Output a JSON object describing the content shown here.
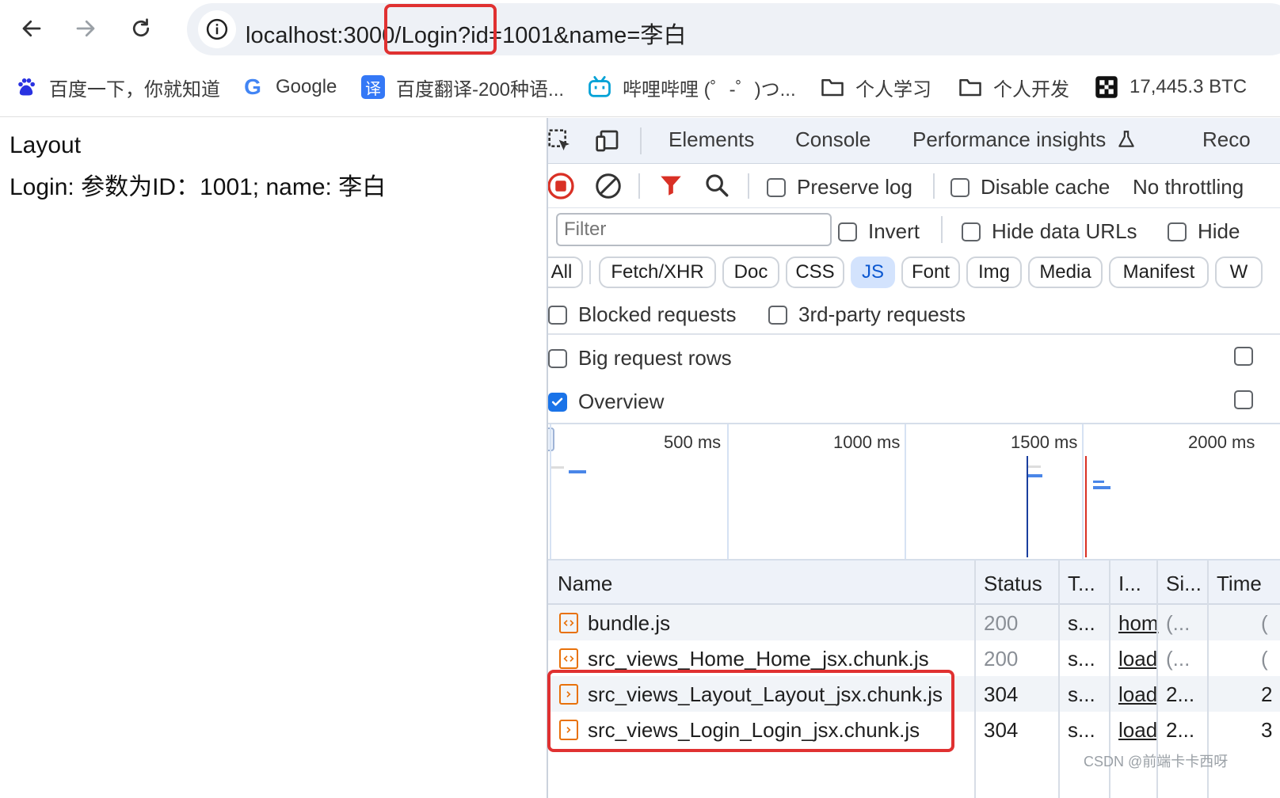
{
  "browser": {
    "url": "localhost:3000/Login?id=1001&name=李白",
    "bookmarks": [
      {
        "label": "百度一下，你就知道",
        "icon": "baidu-paw-icon"
      },
      {
        "label": "Google",
        "icon": "google-g-icon"
      },
      {
        "label": "百度翻译-200种语...",
        "icon": "translate-icon"
      },
      {
        "label": "哔哩哔哩 (゜-゜)つ...",
        "icon": "bilibili-tv-icon"
      },
      {
        "label": "个人学习",
        "icon": "folder-icon"
      },
      {
        "label": "个人开发",
        "icon": "folder-icon"
      },
      {
        "label": "17,445.3 BTC",
        "icon": "qr-icon"
      }
    ]
  },
  "page": {
    "line1": "Layout",
    "line2": "Login: 参数为ID：1001; name: 李白"
  },
  "devtools": {
    "tabs": [
      "Elements",
      "Console",
      "Performance insights",
      "Reco"
    ],
    "toolbar": {
      "preserve_log": "Preserve log",
      "disable_cache": "Disable cache",
      "throttling": "No throttling"
    },
    "filter": {
      "placeholder": "Filter",
      "invert": "Invert",
      "hide_data_urls": "Hide data URLs",
      "hide_ext": "Hide"
    },
    "chips": [
      "All",
      "Fetch/XHR",
      "Doc",
      "CSS",
      "JS",
      "Font",
      "Img",
      "Media",
      "Manifest",
      "W"
    ],
    "active_chip": "JS",
    "blocked_requests": "Blocked requests",
    "third_party": "3rd-party requests",
    "big_rows": "Big request rows",
    "overview": "Overview",
    "timeline_labels": [
      "500 ms",
      "1000 ms",
      "1500 ms",
      "2000 ms"
    ],
    "table": {
      "headers": [
        "Name",
        "Status",
        "T...",
        "I...",
        "Si...",
        "Time"
      ],
      "rows": [
        {
          "name": "bundle.js",
          "status": "200",
          "type": "s...",
          "initiator": "hom",
          "size": "(...",
          "time": "("
        },
        {
          "name": "src_views_Home_Home_jsx.chunk.js",
          "status": "200",
          "type": "s...",
          "initiator": "load",
          "size": "(...",
          "time": "("
        },
        {
          "name": "src_views_Layout_Layout_jsx.chunk.js",
          "status": "304",
          "type": "s...",
          "initiator": "load",
          "size": "2...",
          "time": "2"
        },
        {
          "name": "src_views_Login_Login_jsx.chunk.js",
          "status": "304",
          "type": "s...",
          "initiator": "load",
          "size": "2...",
          "time": "3"
        }
      ]
    }
  },
  "watermark": "CSDN @前端卡卡西呀",
  "colors": {
    "highlight": "#e03131",
    "accent": "#1a73e8",
    "record": "#d93025"
  }
}
